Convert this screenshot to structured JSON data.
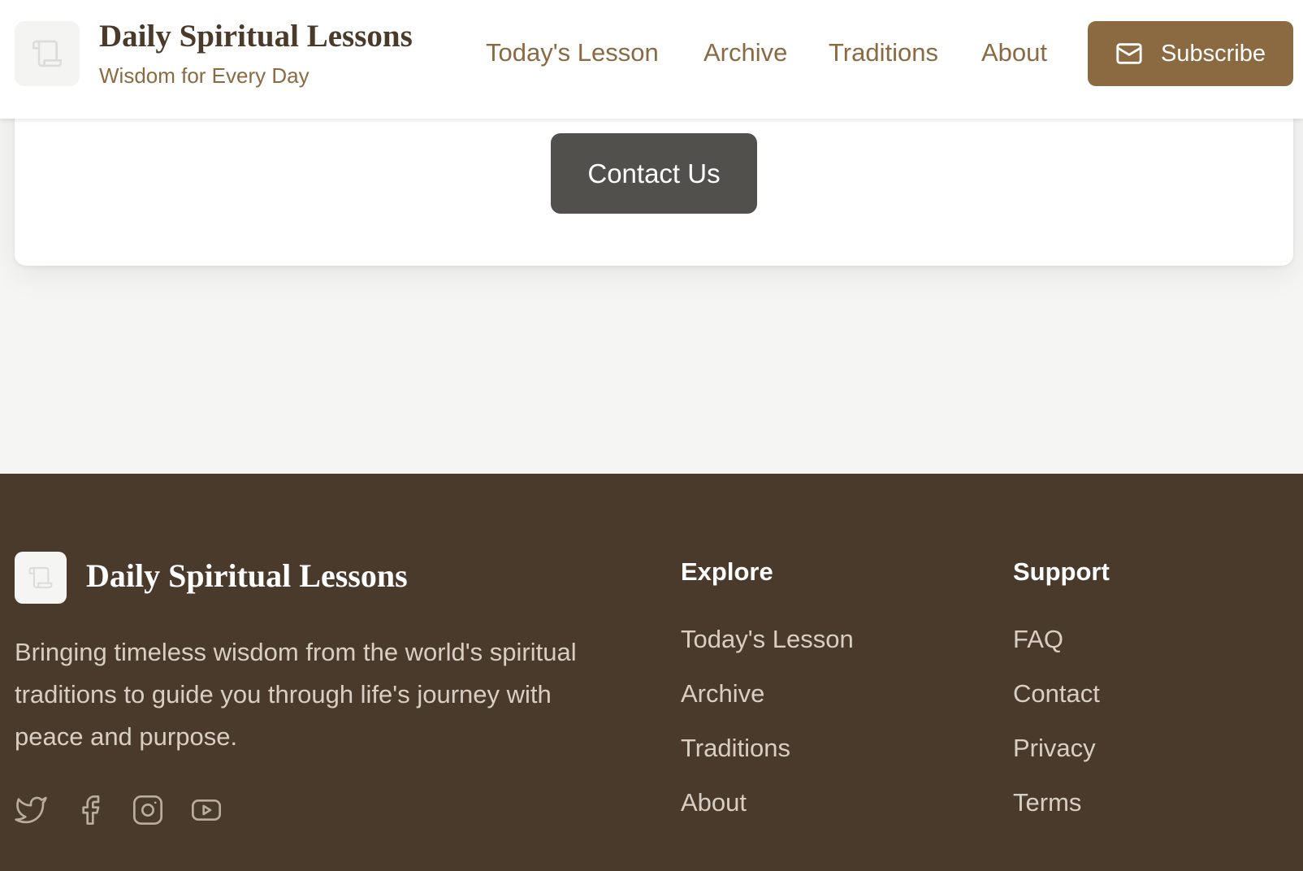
{
  "header": {
    "title": "Daily Spiritual Lessons",
    "tagline": "Wisdom for Every Day",
    "nav": [
      {
        "label": "Today's Lesson"
      },
      {
        "label": "Archive"
      },
      {
        "label": "Traditions"
      },
      {
        "label": "About"
      }
    ],
    "subscribe_label": "Subscribe",
    "subscribe_icon": "mail-icon"
  },
  "card": {
    "contact_label": "Contact Us"
  },
  "footer": {
    "brand": "Daily Spiritual Lessons",
    "description": "Bringing timeless wisdom from the world's spiritual traditions to guide you through life's journey with peace and purpose.",
    "social": [
      "twitter-icon",
      "facebook-icon",
      "instagram-icon",
      "youtube-icon"
    ],
    "explore": {
      "heading": "Explore",
      "links": [
        "Today's Lesson",
        "Archive",
        "Traditions",
        "About"
      ]
    },
    "support": {
      "heading": "Support",
      "links": [
        "FAQ",
        "Contact",
        "Privacy",
        "Terms"
      ]
    }
  },
  "colors": {
    "brand_brown": "#8b6a42",
    "footer_bg": "#4a3a2b",
    "contact_button": "#52504c",
    "page_bg": "#f5f5f4"
  }
}
